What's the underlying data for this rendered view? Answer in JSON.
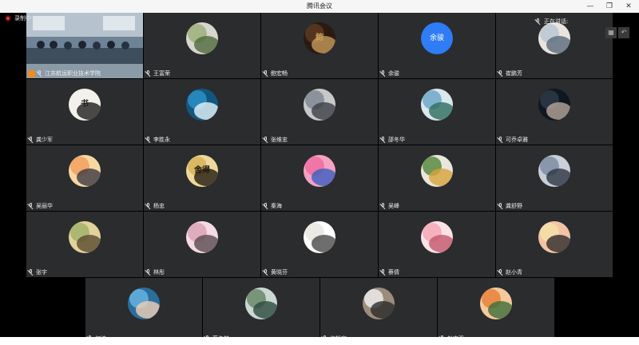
{
  "window": {
    "title": "腾讯会议",
    "minimize": "—",
    "restore": "❐",
    "close": "✕"
  },
  "recording": {
    "label": "录制中",
    "color": "#e23b3b"
  },
  "speaking": {
    "label": "正在讲话:"
  },
  "controls": {
    "grid_view": "▦",
    "back": "↶"
  },
  "participants": [
    {
      "name": "江苏航运职业技术学院",
      "type": "video",
      "avatar_icon": "meeting-room-video"
    },
    {
      "name": "王富荣",
      "avatar_icon": "landscape-photo",
      "colors": [
        "#9fb07a",
        "#4f6a3c",
        "#d8d6cf"
      ]
    },
    {
      "name": "鲍宏畅",
      "avatar_icon": "calligraphy-logo",
      "colors": [
        "#5a3b22",
        "#c79a5a",
        "#2b1a10"
      ],
      "avatar_text": "鲍"
    },
    {
      "name": "余骏",
      "avatar_icon": "text-avatar",
      "avatar_text": "余骏",
      "colors": [
        "#2e7cf6",
        "#2e7cf6",
        "#2e7cf6"
      ]
    },
    {
      "name": "崔鹏芳",
      "avatar_icon": "portrait-photo",
      "colors": [
        "#b9c7d4",
        "#596a7a",
        "#e9e4de"
      ]
    },
    {
      "name": "龚少军",
      "avatar_icon": "calligraphy-scroll",
      "colors": [
        "#f3f1ec",
        "#1e1e1e",
        "#f3f1ec"
      ],
      "avatar_text": "书"
    },
    {
      "name": "李胜永",
      "avatar_icon": "wave-art",
      "colors": [
        "#2c8fc4",
        "#e9f4fa",
        "#13577f"
      ]
    },
    {
      "name": "张维忠",
      "avatar_icon": "person-photo",
      "colors": [
        "#7f8a93",
        "#3b3f44",
        "#c6c9c8"
      ]
    },
    {
      "name": "邵冬华",
      "avatar_icon": "lake-photo",
      "colors": [
        "#6fa8c9",
        "#2f6d5d",
        "#d9e7ee"
      ]
    },
    {
      "name": "可乔卓雅",
      "avatar_icon": "night-photo",
      "colors": [
        "#2d3948",
        "#b7a89a",
        "#0f1720"
      ]
    },
    {
      "name": "吴丽华",
      "avatar_icon": "sunset-photo",
      "colors": [
        "#f1a15f",
        "#3c3a44",
        "#f7d8a2"
      ]
    },
    {
      "name": "杨忠",
      "avatar_icon": "gold-calligraphy",
      "colors": [
        "#d7b45b",
        "#201a10",
        "#eed89a"
      ],
      "avatar_text": "舍得"
    },
    {
      "name": "秦海",
      "avatar_icon": "pink-flower",
      "colors": [
        "#ef6fa0",
        "#3b5fc2",
        "#f6a2c3"
      ]
    },
    {
      "name": "吴峰",
      "avatar_icon": "still-life",
      "colors": [
        "#5a8a3e",
        "#d8a43c",
        "#e9e6dd"
      ]
    },
    {
      "name": "龚舒野",
      "avatar_icon": "building-photo",
      "colors": [
        "#7d8da3",
        "#2c3442",
        "#c9cfd7"
      ]
    },
    {
      "name": "张宇",
      "avatar_icon": "child-photo",
      "colors": [
        "#a3b36b",
        "#5a4a2e",
        "#e3d19b"
      ]
    },
    {
      "name": "林彤",
      "avatar_icon": "cherry-blossom",
      "colors": [
        "#d9a3b6",
        "#5b4a50",
        "#f3dbe4"
      ]
    },
    {
      "name": "黄晓芬",
      "avatar_icon": "white-flower",
      "colors": [
        "#e9e6e1",
        "#4a4a4a",
        "#ffffff"
      ]
    },
    {
      "name": "蔡倩",
      "avatar_icon": "pink-roses",
      "colors": [
        "#f3a9b6",
        "#c4566c",
        "#fbe2e6"
      ]
    },
    {
      "name": "赵小青",
      "avatar_icon": "cartoon-girl",
      "colors": [
        "#f6e1a6",
        "#2f2a2a",
        "#f2c3a5"
      ]
    },
    {
      "name": "何涛",
      "avatar_icon": "baby-photo",
      "colors": [
        "#66b3e0",
        "#f2cfb5",
        "#2a6e9c"
      ]
    },
    {
      "name": "蔡冬林",
      "avatar_icon": "river-landscape",
      "colors": [
        "#6a8a6a",
        "#2c4a3c",
        "#c9d8d2"
      ]
    },
    {
      "name": "许松宁",
      "avatar_icon": "cat-photo",
      "colors": [
        "#ececec",
        "#2a2a2a",
        "#9c8c7a"
      ]
    },
    {
      "name": "赵志强",
      "avatar_icon": "cartoon-fox",
      "colors": [
        "#e8823a",
        "#3b6e3a",
        "#f6c99b"
      ]
    }
  ]
}
